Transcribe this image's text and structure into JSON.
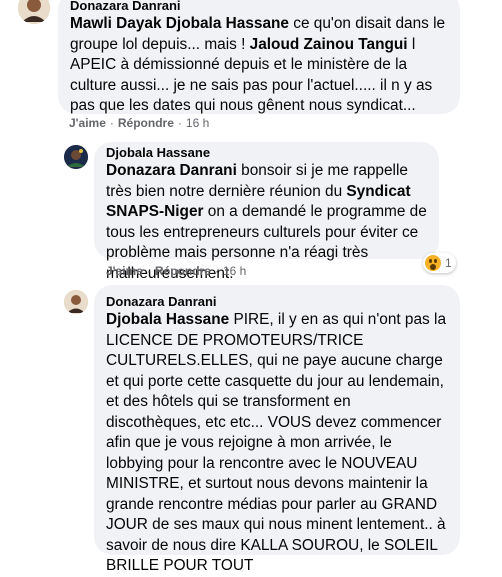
{
  "comments": [
    {
      "author": "Donazara Danrani",
      "mention1": "Mawli Dayak Djobala Hassane",
      "text1": " ce qu'on disait dans le groupe lol depuis... mais ! ",
      "mention2": "Jaloud Zainou Tangui",
      "text2": " l APEIC à démissionné depuis et le ministère de la culture aussi... je ne sais pas pour l'actuel..... il n y as pas que les dates qui nous gênent nous syndicat...",
      "like": "J'aime",
      "reply": "Répondre",
      "time": "16 h"
    },
    {
      "author": "Djobala Hassane",
      "mention1": "Donazara Danrani",
      "text1": " bonsoir si je me rappelle très bien notre dernière réunion du ",
      "mention2": "Syndicat SNAPS-Niger",
      "text2": " on a demandé le programme de tous les entrepreneurs culturels pour éviter ce problème mais personne n'a réagi très malheureusement.",
      "like": "J'aime",
      "reply": "Répondre",
      "time": "16 h",
      "reaction_count": "1"
    },
    {
      "author": "Donazara Danrani",
      "mention1": "Djobala Hassane",
      "text1": " PIRE, il y en as qui n'ont pas la LICENCE DE PROMOTEURS/TRICE CULTURELS.ELLES, qui ne paye aucune charge et qui porte cette casquette du jour au lendemain, et des hôtels qui se transforment en discothèques, etc etc... VOUS devez commencer afin que je vous rejoigne à mon arrivée, le lobbying pour la rencontre avec le NOUVEAU MINISTRE, et surtout nous devons maintenir la grande rencontre médias pour parler au GRAND JOUR de ses maux qui nous minent lentement.. à savoir de nous dire KALLA SOUROU, le SOLEIL BRILLE POUR TOUT"
    }
  ]
}
